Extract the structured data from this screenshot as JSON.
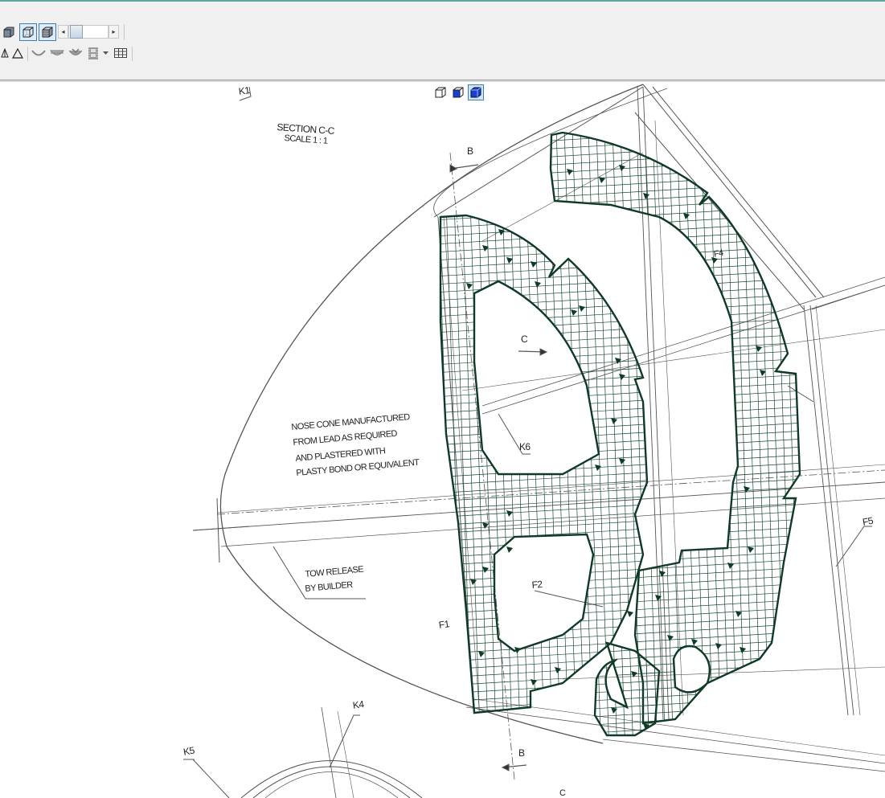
{
  "toolbar": {
    "row1": [
      {
        "name": "shaded-box-icon",
        "active": false
      },
      {
        "name": "wireframe-box-icon",
        "active": true
      },
      {
        "name": "mesh-box-icon",
        "active": true
      }
    ],
    "slider": {
      "left_arrow": "◂",
      "right_arrow": "▸",
      "level": 0.15
    },
    "row2": [
      {
        "name": "hidden-triangle-icon"
      },
      {
        "name": "triangle-outline-icon"
      },
      {
        "name": "curve-bowl-icon"
      },
      {
        "name": "surface-bowl-icon"
      },
      {
        "name": "shell-bowl-icon"
      },
      {
        "name": "film-strip-icon"
      },
      {
        "name": "dropdown-arrow-icon"
      },
      {
        "name": "table-grid-icon"
      }
    ]
  },
  "view_controls": [
    {
      "name": "view-iso-outline-icon",
      "active": false
    },
    {
      "name": "view-iso-blue-icon",
      "active": false
    },
    {
      "name": "view-iso-filled-icon",
      "active": true
    }
  ],
  "drawing": {
    "section_title": "SECTION C-C",
    "section_scale": "SCALE 1 : 1",
    "label_k1": "K1",
    "label_b_top": "B",
    "label_b_bottom": "B",
    "label_c": "C",
    "label_c_bottom": "C",
    "label_k6": "K6",
    "label_f1": "F1",
    "label_f2": "F2",
    "label_f4": "F4",
    "label_f5": "F5",
    "label_k4": "K4",
    "label_k5": "K5",
    "note_nose_line1": "NOSE CONE MANUFACTURED",
    "note_nose_line2": "FROM LEAD AS REQUIRED",
    "note_nose_line3": "AND PLASTERED WITH",
    "note_nose_line4": "PLASTY BOND OR EQUIVALENT",
    "note_tow_line1": "TOW RELEASE",
    "note_tow_line2": "BY BUILDER"
  },
  "colors": {
    "mesh": "#1d4a36",
    "mesh_outline": "#0f3a26",
    "drawing_line": "#555555",
    "toolbar_bg": "#f0f0f0",
    "active_blue": "#1a3fd6"
  }
}
